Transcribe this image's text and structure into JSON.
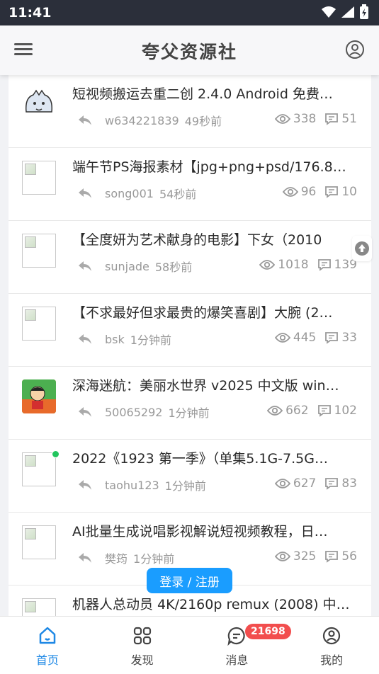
{
  "status": {
    "time": "11:41"
  },
  "header": {
    "site_name": "夸父资源社"
  },
  "posts": [
    {
      "title": "短视频搬运去重二创 2.4.0 Android 免费…",
      "user": "w634221839",
      "time": "49秒前",
      "views": "338",
      "comments": "51",
      "thumb": "avatar1"
    },
    {
      "title": "端午节PS海报素材【jpg+png+psd/176.8…",
      "user": "song001",
      "time": "54秒前",
      "views": "96",
      "comments": "10",
      "thumb": "broken"
    },
    {
      "title": "【全度妍为艺术献身的电影】下女（2010",
      "user": "sunjade",
      "time": "58秒前",
      "views": "1018",
      "comments": "139",
      "thumb": "broken"
    },
    {
      "title": "【不求最好但求最贵的爆笑喜剧】大腕 (2…",
      "user": "bsk",
      "time": "1分钟前",
      "views": "445",
      "comments": "33",
      "thumb": "broken"
    },
    {
      "title": "深海迷航：美丽水世界 v2025 中文版 win…",
      "user": "50065292",
      "time": "1分钟前",
      "views": "662",
      "comments": "102",
      "thumb": "avatar2"
    },
    {
      "title": "2022《1923 第一季》（单集5.1G-7.5G…",
      "user": "taohu123",
      "time": "1分钟前",
      "views": "627",
      "comments": "83",
      "thumb": "broken",
      "online": true
    },
    {
      "title": "AI批量生成说唱影视解说短视频教程，日…",
      "user": "樊筠",
      "time": "1分钟前",
      "views": "325",
      "comments": "56",
      "thumb": "broken"
    },
    {
      "title": "机器人总动员 4K/2160p remux (2008) 中…",
      "user": "",
      "time": "",
      "views": "",
      "comments": "",
      "thumb": "broken"
    }
  ],
  "login_button": "登录 / 注册",
  "tabs": [
    {
      "label": "首页",
      "icon": "home-icon",
      "active": true
    },
    {
      "label": "发现",
      "icon": "grid-icon"
    },
    {
      "label": "消息",
      "icon": "message-icon"
    },
    {
      "label": "我的",
      "icon": "profile-icon"
    }
  ],
  "message_badge": "21698",
  "colors": {
    "accent": "#1e88e5",
    "login": "#1a9dff",
    "badge": "#f24e4e",
    "statusbar": "#2b2f3a"
  }
}
